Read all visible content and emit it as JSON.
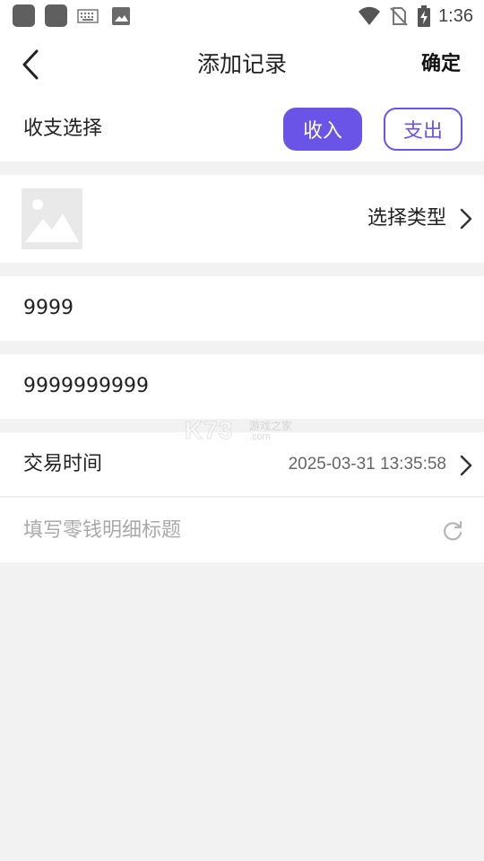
{
  "status_bar": {
    "time": "1:36",
    "icons": [
      "app-square-icon",
      "app-square-icon",
      "keyboard-icon",
      "image-icon",
      "wifi-icon",
      "no-sim-icon",
      "battery-charging-icon"
    ]
  },
  "header": {
    "title": "添加记录",
    "confirm_label": "确定",
    "back_icon": "chevron-left-icon"
  },
  "income_expense": {
    "label": "收支选择",
    "income_label": "收入",
    "expense_label": "支出",
    "selected": "收入",
    "accent_color": "#6a54e8"
  },
  "category": {
    "placeholder_icon": "image-placeholder-icon",
    "select_label": "选择类型"
  },
  "fields": {
    "amount": "9999",
    "note": "9999999999"
  },
  "transaction_time": {
    "label": "交易时间",
    "value": "2025-03-31 13:35:58"
  },
  "title_field": {
    "placeholder": "填写零钱明细标题",
    "value": ""
  },
  "watermark": {
    "logo": "K73",
    "text_cn": "游戏之家",
    "text_com": ".com"
  }
}
